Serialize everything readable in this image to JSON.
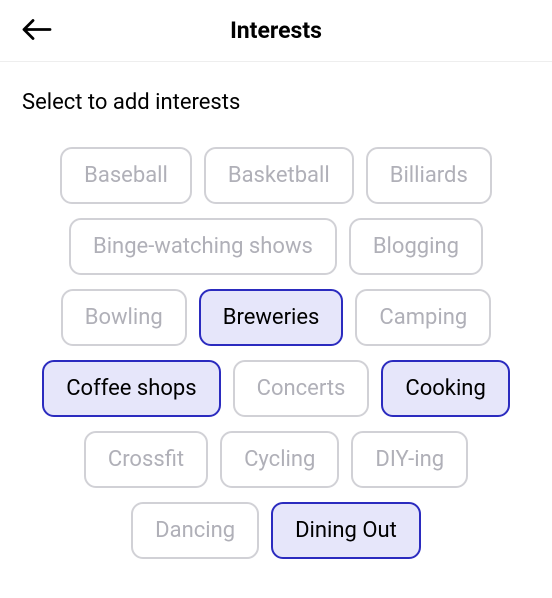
{
  "header": {
    "title": "Interests"
  },
  "instruction": "Select to add interests",
  "interests": [
    {
      "label": "Baseball",
      "selected": false
    },
    {
      "label": "Basketball",
      "selected": false
    },
    {
      "label": "Billiards",
      "selected": false
    },
    {
      "label": "Binge-watching shows",
      "selected": false
    },
    {
      "label": "Blogging",
      "selected": false
    },
    {
      "label": "Bowling",
      "selected": false
    },
    {
      "label": "Breweries",
      "selected": true
    },
    {
      "label": "Camping",
      "selected": false
    },
    {
      "label": "Coffee shops",
      "selected": true
    },
    {
      "label": "Concerts",
      "selected": false
    },
    {
      "label": "Cooking",
      "selected": true
    },
    {
      "label": "Crossfit",
      "selected": false
    },
    {
      "label": "Cycling",
      "selected": false
    },
    {
      "label": "DIY-ing",
      "selected": false
    },
    {
      "label": "Dancing",
      "selected": false
    },
    {
      "label": "Dining Out",
      "selected": true
    }
  ]
}
